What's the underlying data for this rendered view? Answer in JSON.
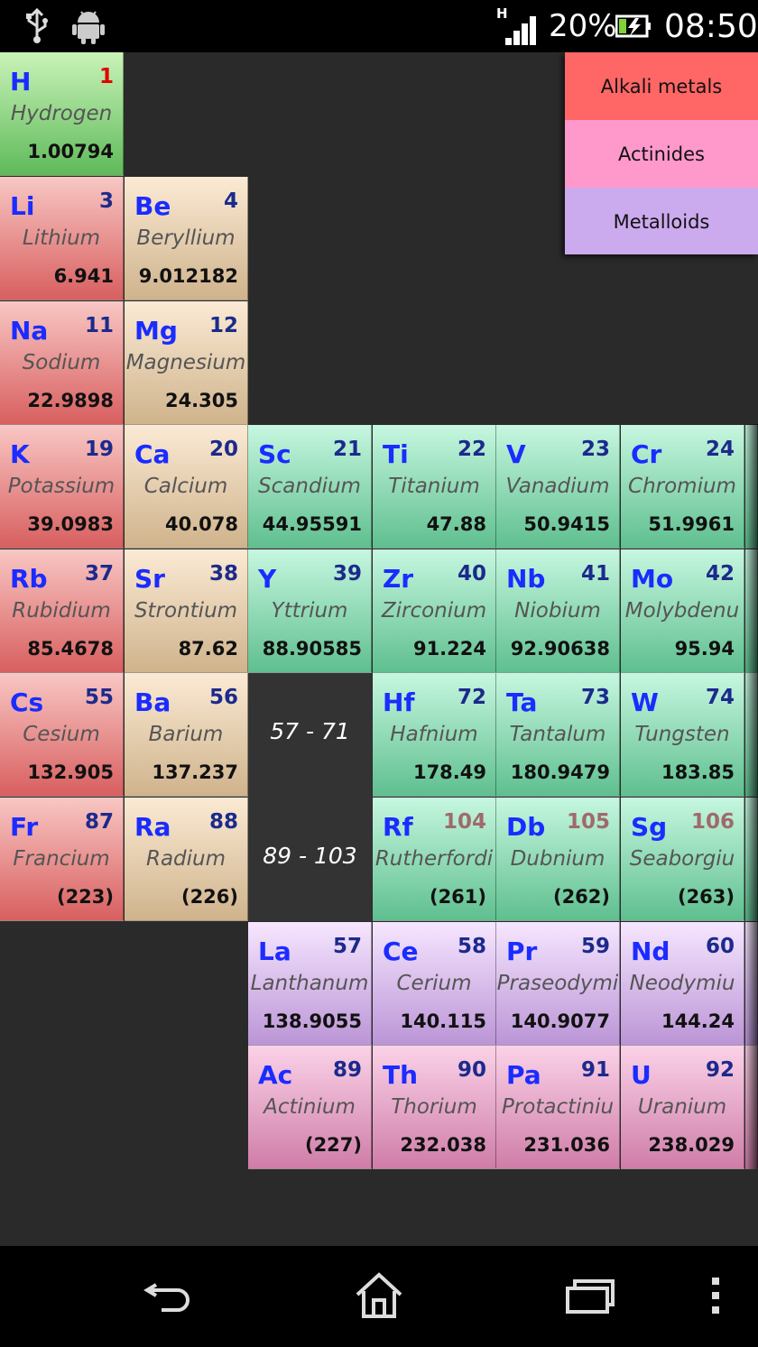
{
  "status_bar": {
    "network_type": "H",
    "battery_percent": "20%",
    "time": "08:50",
    "icons": [
      "usb-icon",
      "android-debug-icon",
      "signal-icon",
      "battery-charging-icon"
    ]
  },
  "legend": {
    "items": [
      {
        "label": "Alkali metals",
        "color": "#ff6666"
      },
      {
        "label": "Actinides",
        "color": "#ff99cc"
      },
      {
        "label": "Metalloids",
        "color": "#ccaaee"
      }
    ]
  },
  "placeholders": {
    "lanthanides_range": "57 - 71",
    "actinides_range": "89 - 103"
  },
  "elements": [
    {
      "symbol": "H",
      "number": "1",
      "name": "Hydrogen",
      "weight": "1.00794"
    },
    {
      "symbol": "Li",
      "number": "3",
      "name": "Lithium",
      "weight": "6.941"
    },
    {
      "symbol": "Be",
      "number": "4",
      "name": "Beryllium",
      "weight": "9.012182"
    },
    {
      "symbol": "Na",
      "number": "11",
      "name": "Sodium",
      "weight": "22.9898"
    },
    {
      "symbol": "Mg",
      "number": "12",
      "name": "Magnesium",
      "weight": "24.305"
    },
    {
      "symbol": "K",
      "number": "19",
      "name": "Potassium",
      "weight": "39.0983"
    },
    {
      "symbol": "Ca",
      "number": "20",
      "name": "Calcium",
      "weight": "40.078"
    },
    {
      "symbol": "Sc",
      "number": "21",
      "name": "Scandium",
      "weight": "44.95591"
    },
    {
      "symbol": "Ti",
      "number": "22",
      "name": "Titanium",
      "weight": "47.88"
    },
    {
      "symbol": "V",
      "number": "23",
      "name": "Vanadium",
      "weight": "50.9415"
    },
    {
      "symbol": "Cr",
      "number": "24",
      "name": "Chromium",
      "weight": "51.9961"
    },
    {
      "symbol": "Rb",
      "number": "37",
      "name": "Rubidium",
      "weight": "85.4678"
    },
    {
      "symbol": "Sr",
      "number": "38",
      "name": "Strontium",
      "weight": "87.62"
    },
    {
      "symbol": "Y",
      "number": "39",
      "name": "Yttrium",
      "weight": "88.90585"
    },
    {
      "symbol": "Zr",
      "number": "40",
      "name": "Zirconium",
      "weight": "91.224"
    },
    {
      "symbol": "Nb",
      "number": "41",
      "name": "Niobium",
      "weight": "92.90638"
    },
    {
      "symbol": "Mo",
      "number": "42",
      "name": "Molybdenu",
      "weight": "95.94"
    },
    {
      "symbol": "Cs",
      "number": "55",
      "name": "Cesium",
      "weight": "132.905"
    },
    {
      "symbol": "Ba",
      "number": "56",
      "name": "Barium",
      "weight": "137.237"
    },
    {
      "symbol": "Hf",
      "number": "72",
      "name": "Hafnium",
      "weight": "178.49"
    },
    {
      "symbol": "Ta",
      "number": "73",
      "name": "Tantalum",
      "weight": "180.9479"
    },
    {
      "symbol": "W",
      "number": "74",
      "name": "Tungsten",
      "weight": "183.85"
    },
    {
      "symbol": "Fr",
      "number": "87",
      "name": "Francium",
      "weight": "(223)"
    },
    {
      "symbol": "Ra",
      "number": "88",
      "name": "Radium",
      "weight": "(226)"
    },
    {
      "symbol": "Rf",
      "number": "104",
      "name": "Rutherfordi",
      "weight": "(261)"
    },
    {
      "symbol": "Db",
      "number": "105",
      "name": "Dubnium",
      "weight": "(262)"
    },
    {
      "symbol": "Sg",
      "number": "106",
      "name": "Seaborgiu",
      "weight": "(263)"
    },
    {
      "symbol": "La",
      "number": "57",
      "name": "Lanthanum",
      "weight": "138.9055"
    },
    {
      "symbol": "Ce",
      "number": "58",
      "name": "Cerium",
      "weight": "140.115"
    },
    {
      "symbol": "Pr",
      "number": "59",
      "name": "Praseodymi",
      "weight": "140.9077"
    },
    {
      "symbol": "Nd",
      "number": "60",
      "name": "Neodymiu",
      "weight": "144.24"
    },
    {
      "symbol": "Ac",
      "number": "89",
      "name": "Actinium",
      "weight": "(227)"
    },
    {
      "symbol": "Th",
      "number": "90",
      "name": "Thorium",
      "weight": "232.038"
    },
    {
      "symbol": "Pa",
      "number": "91",
      "name": "Protactiniu",
      "weight": "231.036"
    },
    {
      "symbol": "U",
      "number": "92",
      "name": "Uranium",
      "weight": "238.029"
    }
  ],
  "nav_bar": {
    "buttons": [
      "back-icon",
      "home-icon",
      "recent-apps-icon",
      "menu-icon"
    ]
  }
}
